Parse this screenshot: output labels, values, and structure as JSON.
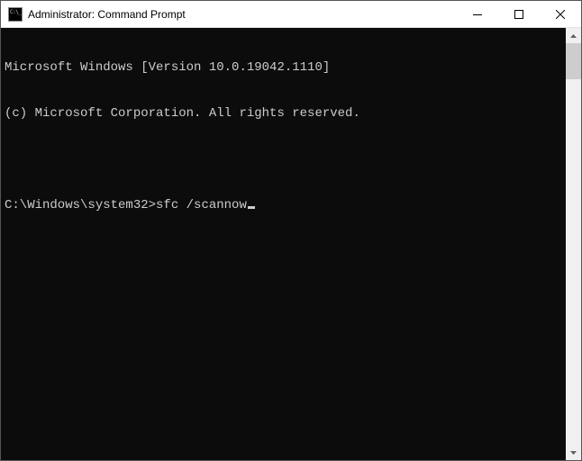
{
  "window": {
    "title": "Administrator: Command Prompt"
  },
  "terminal": {
    "line1": "Microsoft Windows [Version 10.0.19042.1110]",
    "line2": "(c) Microsoft Corporation. All rights reserved.",
    "prompt": "C:\\Windows\\system32>",
    "command": "sfc /scannow"
  },
  "colors": {
    "terminal_bg": "#0c0c0c",
    "terminal_fg": "#cccccc",
    "titlebar_bg": "#ffffff"
  }
}
